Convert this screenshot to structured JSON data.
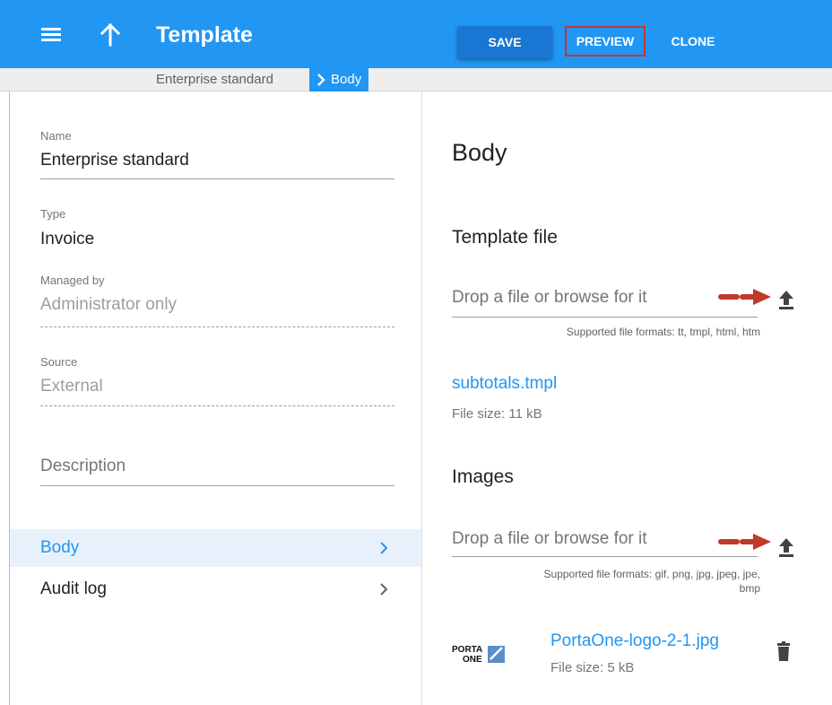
{
  "appbar": {
    "title": "Template",
    "icons": {
      "menu": "menu-icon",
      "up": "arrow-up-icon"
    },
    "buttons": {
      "save": "SAVE",
      "preview": "PREVIEW",
      "clone": "CLONE"
    },
    "color": "#2196f3"
  },
  "breadcrumb": {
    "items": [
      "Enterprise standard",
      "Body"
    ]
  },
  "left": {
    "name": {
      "label": "Name",
      "value": "Enterprise standard"
    },
    "type": {
      "label": "Type",
      "value": "Invoice"
    },
    "managed_by": {
      "label": "Managed by",
      "value": "Administrator only"
    },
    "source": {
      "label": "Source",
      "value": "External"
    },
    "description": {
      "placeholder": "Description"
    },
    "nav": [
      {
        "label": "Body",
        "active": true
      },
      {
        "label": "Audit log",
        "active": false
      }
    ]
  },
  "right": {
    "title": "Body",
    "template_file": {
      "title": "Template file",
      "drop_text": "Drop a file or browse for it",
      "hint": "Supported file formats: tt, tmpl, html, htm",
      "file_name": "subtotals.tmpl",
      "file_size": "File size: 11 kB"
    },
    "images": {
      "title": "Images",
      "drop_text": "Drop a file or browse for it",
      "hint_line1": "Supported file formats: gif, png, jpg, jpeg, jpe,",
      "hint_line2": "bmp",
      "file_name": "PortaOne-logo-2-1.jpg",
      "file_size": "File size: 5 kB",
      "logo_text": {
        "line1": "PORTA",
        "line2": "ONE"
      }
    }
  },
  "colors": {
    "accent": "#2196f3",
    "annotation": "#c0392b"
  }
}
